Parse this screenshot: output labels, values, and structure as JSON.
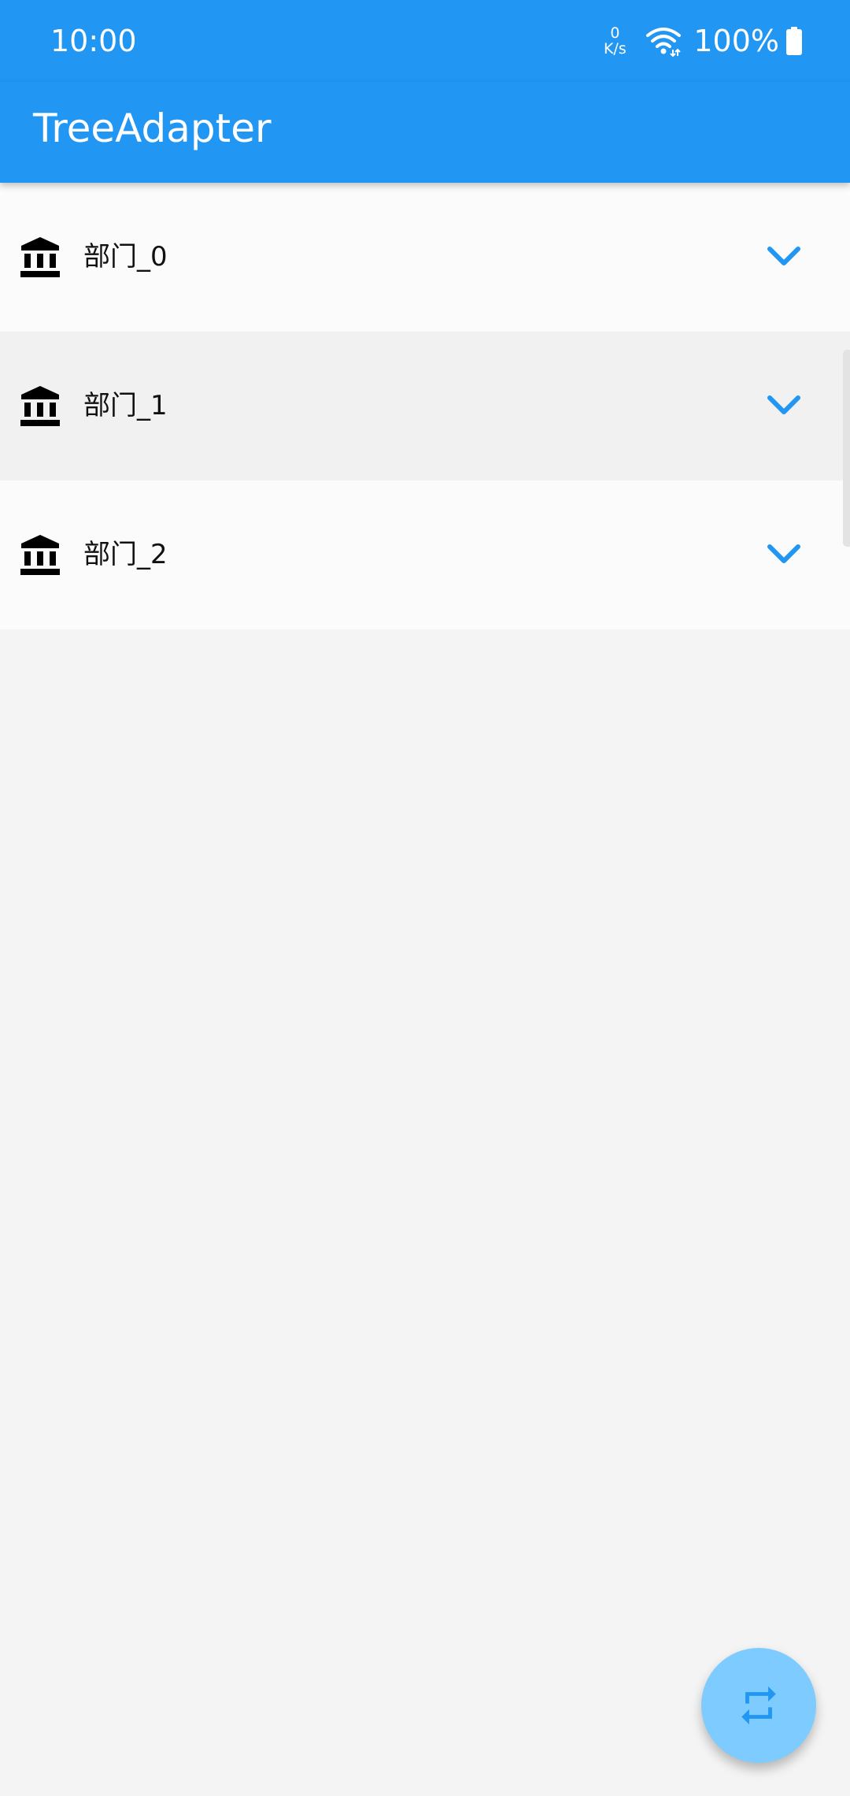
{
  "status_bar": {
    "time": "10:00",
    "net_speed_value": "0",
    "net_speed_unit": "K/s",
    "battery": "100%",
    "icons": [
      "wifi-icon",
      "battery-icon"
    ]
  },
  "app_bar": {
    "title": "TreeAdapter"
  },
  "tree": {
    "items": [
      {
        "label": "部门_0",
        "icon": "bank-icon",
        "expand_icon": "chevron-down-icon"
      },
      {
        "label": "部门_1",
        "icon": "bank-icon",
        "expand_icon": "chevron-down-icon"
      },
      {
        "label": "部门_2",
        "icon": "bank-icon",
        "expand_icon": "chevron-down-icon"
      }
    ]
  },
  "fab": {
    "icon": "repeat-icon"
  },
  "colors": {
    "primary": "#2196f3",
    "fab_background": "#7ecbff",
    "row_background": "#fbfbfb",
    "row_alt_background": "#f1f1f1",
    "page_background": "#f4f4f4"
  }
}
